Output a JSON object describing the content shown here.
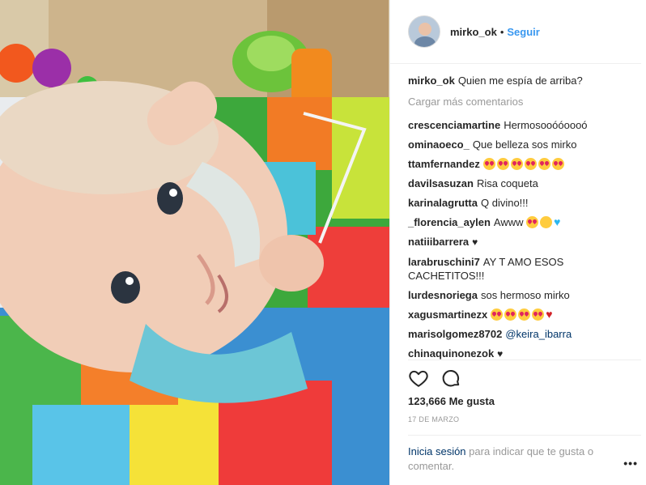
{
  "header": {
    "username": "mirko_ok",
    "separator": "•",
    "follow_label": "Seguir"
  },
  "caption": {
    "username": "mirko_ok",
    "text": "Quien me espía de arriba?"
  },
  "load_more_label": "Cargar más comentarios",
  "comments": [
    {
      "user": "crescenciamartine",
      "text": "Hermosooóóoooó",
      "emoji": []
    },
    {
      "user": "ominaoeco_",
      "text": "Que belleza sos mirko",
      "emoji": []
    },
    {
      "user": "ttamfernandez",
      "text": "",
      "emoji": [
        "love",
        "love",
        "love",
        "love",
        "love",
        "love"
      ]
    },
    {
      "user": "davilsasuzan",
      "text": "Risa coqueta",
      "emoji": []
    },
    {
      "user": "karinalagrutta",
      "text": "Q divino!!!",
      "emoji": []
    },
    {
      "user": "_florencia_aylen",
      "text": "Awww",
      "emoji": [
        "love",
        "blush",
        "heartblue"
      ]
    },
    {
      "user": "natiiibarrera",
      "text": "",
      "emoji": [
        "heartblack"
      ]
    },
    {
      "user": "larabruschini7",
      "text": "AY T AMO ESOS CACHETITOS!!!",
      "emoji": []
    },
    {
      "user": "lurdesnoriega",
      "text": "sos hermoso mirko",
      "emoji": []
    },
    {
      "user": "xagusmartinezx",
      "text": "",
      "emoji": [
        "love",
        "love",
        "love",
        "love",
        "broken"
      ]
    },
    {
      "user": "marisolgomez8702",
      "text": "",
      "mention": "@keira_ibarra",
      "emoji": []
    },
    {
      "user": "chinaquinonezok",
      "text": "",
      "emoji": [
        "heartblack"
      ]
    }
  ],
  "icons": {
    "like": "heart-outline-icon",
    "comment": "speech-bubble-icon",
    "more": "ellipsis-icon"
  },
  "likes": "123,666 Me gusta",
  "date": "17 DE MARZO",
  "login": {
    "link": "Inicia sesión",
    "text": " para indicar que te gusta o comentar."
  },
  "more_label": "•••"
}
